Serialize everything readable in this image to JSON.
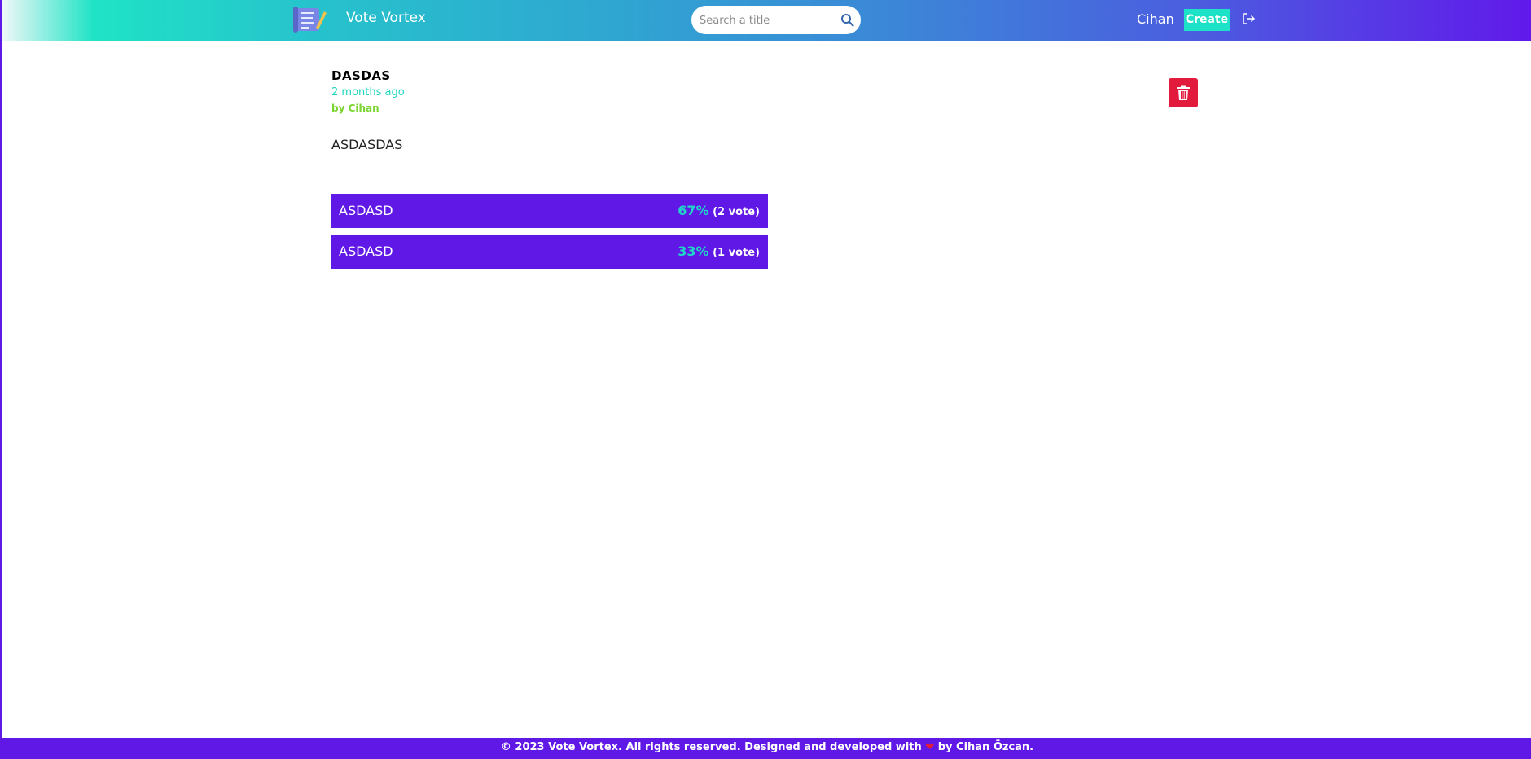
{
  "header": {
    "brand": "Vote Vortex",
    "search_placeholder": "Search a title",
    "username": "Cihan",
    "create_label": "Create"
  },
  "post": {
    "title": "DASDAS",
    "time": "2 months ago",
    "author": "by Cihan",
    "description": "ASDASDAS",
    "options": [
      {
        "label": "ASDASD",
        "percent": "67%",
        "votes": "(2 vote)"
      },
      {
        "label": "ASDASD",
        "percent": "33%",
        "votes": "(1 vote)"
      }
    ]
  },
  "footer": {
    "text_before": "© 2023 Vote Vortex. All rights reserved. Designed and developed with",
    "heart": "❤",
    "text_after": "by Cihan Özcan."
  },
  "colors": {
    "accent_purple": "#6018e6",
    "accent_teal": "#1ee2c8",
    "delete_red": "#e21a3b",
    "author_green": "#7bd530"
  },
  "icons": [
    "logo-icon",
    "search-icon",
    "logout-icon",
    "trash-icon"
  ]
}
